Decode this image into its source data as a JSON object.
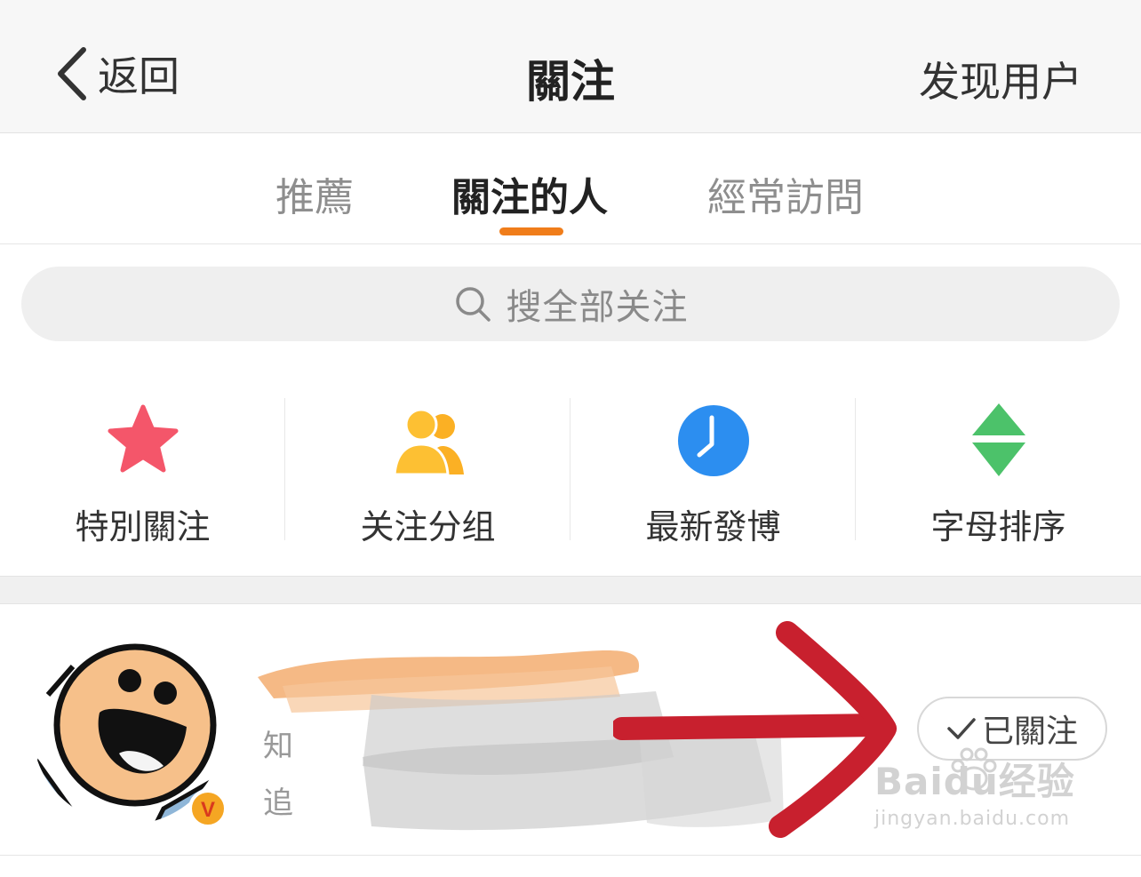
{
  "header": {
    "back_label": "返回",
    "title": "關注",
    "right_action": "发现用户"
  },
  "tabs": [
    {
      "label": "推薦",
      "active": false
    },
    {
      "label": "關注的人",
      "active": true
    },
    {
      "label": "經常訪問",
      "active": false
    }
  ],
  "accent_color": "#f07d1a",
  "search": {
    "placeholder": "搜全部关注"
  },
  "quick_actions": [
    {
      "label": "特別關注",
      "icon": "star-icon",
      "color": "#f4566a"
    },
    {
      "label": "关注分组",
      "icon": "group-icon",
      "color": "#fbb024"
    },
    {
      "label": "最新發博",
      "icon": "clock-icon",
      "color": "#2c8ef0"
    },
    {
      "label": "字母排序",
      "icon": "sort-icon",
      "color": "#4cc26a"
    }
  ],
  "user_row": {
    "info_line_1": "知",
    "info_line_2": "追",
    "follow_label": "已關注",
    "verified_badge": "V"
  },
  "watermark": {
    "main": "Baidu经验",
    "sub": "jingyan.baidu.com"
  }
}
